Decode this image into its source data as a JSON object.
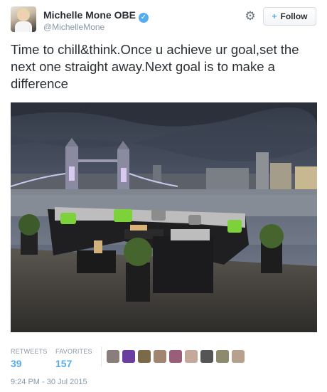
{
  "user": {
    "display_name": "Michelle Mone OBE",
    "handle": "@MichelleMone",
    "verified_icon": "verified-badge-icon",
    "verified_glyph": "✓"
  },
  "actions": {
    "settings_icon": "gear-icon",
    "follow_label": "Follow",
    "follow_icon": "add-person-icon",
    "follow_glyph": "+"
  },
  "tweet": {
    "text": "Time to chill&think.Once u achieve ur goal,set the next one straight away.Next goal is to make a difference"
  },
  "stats": {
    "retweets_label": "RETWEETS",
    "retweets_value": "39",
    "favorites_label": "FAVORITES",
    "favorites_value": "157"
  },
  "favorited_by": {
    "avatar_colors": [
      "#8a7e7a",
      "#6b3fa0",
      "#7a6a48",
      "#a0866e",
      "#9b5e7a",
      "#c4a89a",
      "#555555",
      "#8e8a6e",
      "#b8a08e"
    ]
  },
  "timestamp": "9:24 PM - 30 Jul 2015",
  "colors": {
    "accent": "#55acee",
    "name": "#292f33",
    "muted": "#8899a6"
  }
}
